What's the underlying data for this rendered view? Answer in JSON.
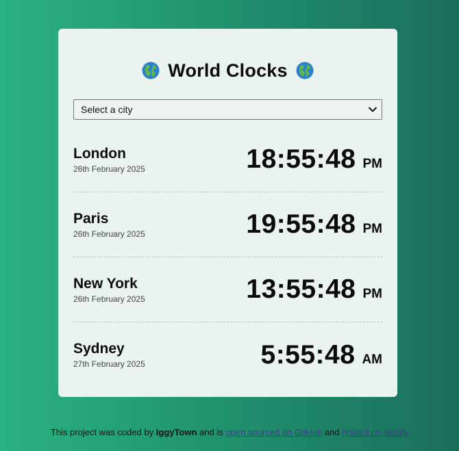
{
  "header": {
    "title": "World Clocks",
    "left_icon": "globe-icon",
    "right_icon": "globe-icon"
  },
  "city_select": {
    "selected": "Select a city"
  },
  "cities": [
    {
      "name": "London",
      "date": "26th February 2025",
      "time": "18:55:48",
      "ampm": "PM"
    },
    {
      "name": "Paris",
      "date": "26th February 2025",
      "time": "19:55:48",
      "ampm": "PM"
    },
    {
      "name": "New York",
      "date": "26th February 2025",
      "time": "13:55:48",
      "ampm": "PM"
    },
    {
      "name": "Sydney",
      "date": "27th February 2025",
      "time": "5:55:48",
      "ampm": "AM"
    }
  ],
  "footer": {
    "text_before": "This project was coded by ",
    "author": "IggyTown",
    "text_middle": " and is ",
    "github_link": "open sourced on GitHub",
    "text_and": " and ",
    "netlify_link": "hosted on Netlify"
  },
  "colors": {
    "background_start": "#2bb282",
    "background_end": "#1b6e5c",
    "card": "#eaf3f0",
    "link": "#3d3c8e"
  }
}
